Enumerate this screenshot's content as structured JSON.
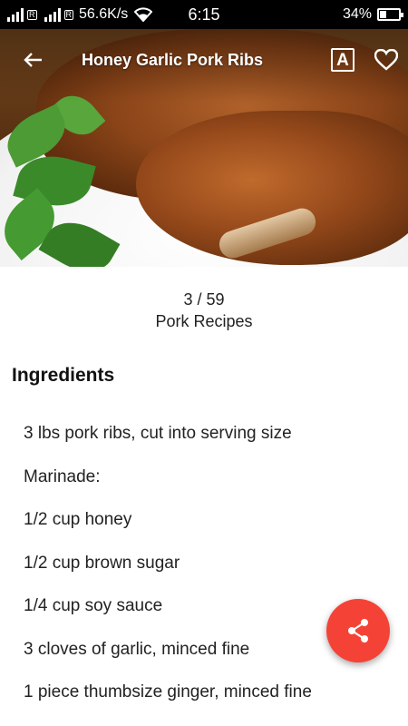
{
  "status_bar": {
    "network_speed": "56.6K/s",
    "time": "6:15",
    "battery_percent": "34%",
    "battery_level": 0.34,
    "sim_badge": "R"
  },
  "toolbar": {
    "title": "Honey Garlic Pork Ribs",
    "font_icon_letter": "A"
  },
  "counter": {
    "position": "3 / 59",
    "category": "Pork Recipes"
  },
  "section": {
    "title": "Ingredients"
  },
  "ingredients": [
    "3 lbs pork ribs, cut into serving size",
    "Marinade:",
    "1/2 cup honey",
    "1/2 cup brown sugar",
    "1/4 cup soy sauce",
    "3 cloves of garlic, minced fine",
    "1 piece thumbsize ginger, minced fine"
  ],
  "colors": {
    "fab": "#f44336",
    "status_bar": "#000000"
  },
  "icons": {
    "back": "arrow-left-icon",
    "font_size": "font-size-icon",
    "favorite": "heart-outline-icon",
    "share": "share-icon"
  }
}
